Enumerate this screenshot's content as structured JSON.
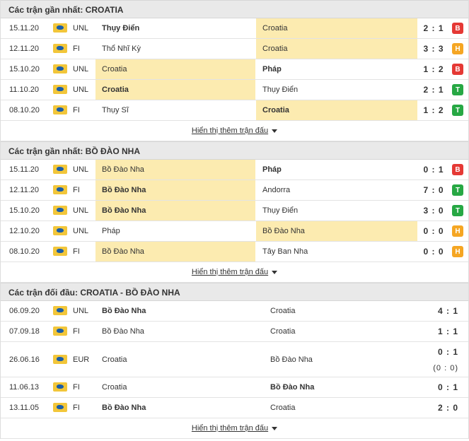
{
  "sections": [
    {
      "title": "Các trận gần nhất: CROATIA",
      "more_label": "Hiển thị thêm trận đấu",
      "matches": [
        {
          "date": "15.11.20",
          "comp": "UNL",
          "home": "Thụy Điển",
          "away": "Croatia",
          "score": "2 : 1",
          "result": "B",
          "result_color": "#e53935",
          "home_bold": true,
          "away_bold": false,
          "highlight": "away"
        },
        {
          "date": "12.11.20",
          "comp": "FI",
          "home": "Thổ Nhĩ Kỳ",
          "away": "Croatia",
          "score": "3 : 3",
          "result": "H",
          "result_color": "#f5a623",
          "home_bold": false,
          "away_bold": false,
          "highlight": "away"
        },
        {
          "date": "15.10.20",
          "comp": "UNL",
          "home": "Croatia",
          "away": "Pháp",
          "score": "1 : 2",
          "result": "B",
          "result_color": "#e53935",
          "home_bold": false,
          "away_bold": true,
          "highlight": "home"
        },
        {
          "date": "11.10.20",
          "comp": "UNL",
          "home": "Croatia",
          "away": "Thụy Điển",
          "score": "2 : 1",
          "result": "T",
          "result_color": "#27a844",
          "home_bold": true,
          "away_bold": false,
          "highlight": "home"
        },
        {
          "date": "08.10.20",
          "comp": "FI",
          "home": "Thụy Sĩ",
          "away": "Croatia",
          "score": "1 : 2",
          "result": "T",
          "result_color": "#27a844",
          "home_bold": false,
          "away_bold": true,
          "highlight": "away"
        }
      ]
    },
    {
      "title": "Các trận gần nhất: BỒ ĐÀO NHA",
      "more_label": "Hiển thị thêm trận đấu",
      "matches": [
        {
          "date": "15.11.20",
          "comp": "UNL",
          "home": "Bồ Đào Nha",
          "away": "Pháp",
          "score": "0 : 1",
          "result": "B",
          "result_color": "#e53935",
          "home_bold": false,
          "away_bold": true,
          "highlight": "home"
        },
        {
          "date": "12.11.20",
          "comp": "FI",
          "home": "Bồ Đào Nha",
          "away": "Andorra",
          "score": "7 : 0",
          "result": "T",
          "result_color": "#27a844",
          "home_bold": true,
          "away_bold": false,
          "highlight": "home"
        },
        {
          "date": "15.10.20",
          "comp": "UNL",
          "home": "Bồ Đào Nha",
          "away": "Thụy Điển",
          "score": "3 : 0",
          "result": "T",
          "result_color": "#27a844",
          "home_bold": true,
          "away_bold": false,
          "highlight": "home"
        },
        {
          "date": "12.10.20",
          "comp": "UNL",
          "home": "Pháp",
          "away": "Bồ Đào Nha",
          "score": "0 : 0",
          "result": "H",
          "result_color": "#f5a623",
          "home_bold": false,
          "away_bold": false,
          "highlight": "away"
        },
        {
          "date": "08.10.20",
          "comp": "FI",
          "home": "Bồ Đào Nha",
          "away": "Tây Ban Nha",
          "score": "0 : 0",
          "result": "H",
          "result_color": "#f5a623",
          "home_bold": false,
          "away_bold": false,
          "highlight": "home"
        }
      ]
    }
  ],
  "h2h": {
    "title": "Các trận đối đầu: CROATIA - BỒ ĐÀO NHA",
    "more_label": "Hiển thị thêm trận đấu",
    "matches": [
      {
        "date": "06.09.20",
        "comp": "UNL",
        "home": "Bồ Đào Nha",
        "away": "Croatia",
        "score": "4 : 1",
        "sub": "",
        "home_bold": true,
        "away_bold": false
      },
      {
        "date": "07.09.18",
        "comp": "FI",
        "home": "Bồ Đào Nha",
        "away": "Croatia",
        "score": "1 : 1",
        "sub": "",
        "home_bold": false,
        "away_bold": false
      },
      {
        "date": "26.06.16",
        "comp": "EUR",
        "home": "Croatia",
        "away": "Bồ Đào Nha",
        "score": "0 : 1",
        "sub": "(0 : 0)",
        "home_bold": false,
        "away_bold": false
      },
      {
        "date": "11.06.13",
        "comp": "FI",
        "home": "Croatia",
        "away": "Bồ Đào Nha",
        "score": "0 : 1",
        "sub": "",
        "home_bold": false,
        "away_bold": true
      },
      {
        "date": "13.11.05",
        "comp": "FI",
        "home": "Bồ Đào Nha",
        "away": "Croatia",
        "score": "2 : 0",
        "sub": "",
        "home_bold": true,
        "away_bold": false
      }
    ]
  },
  "icons": {
    "competition": "world-map-flag-icon",
    "more": "caret-down-icon"
  }
}
